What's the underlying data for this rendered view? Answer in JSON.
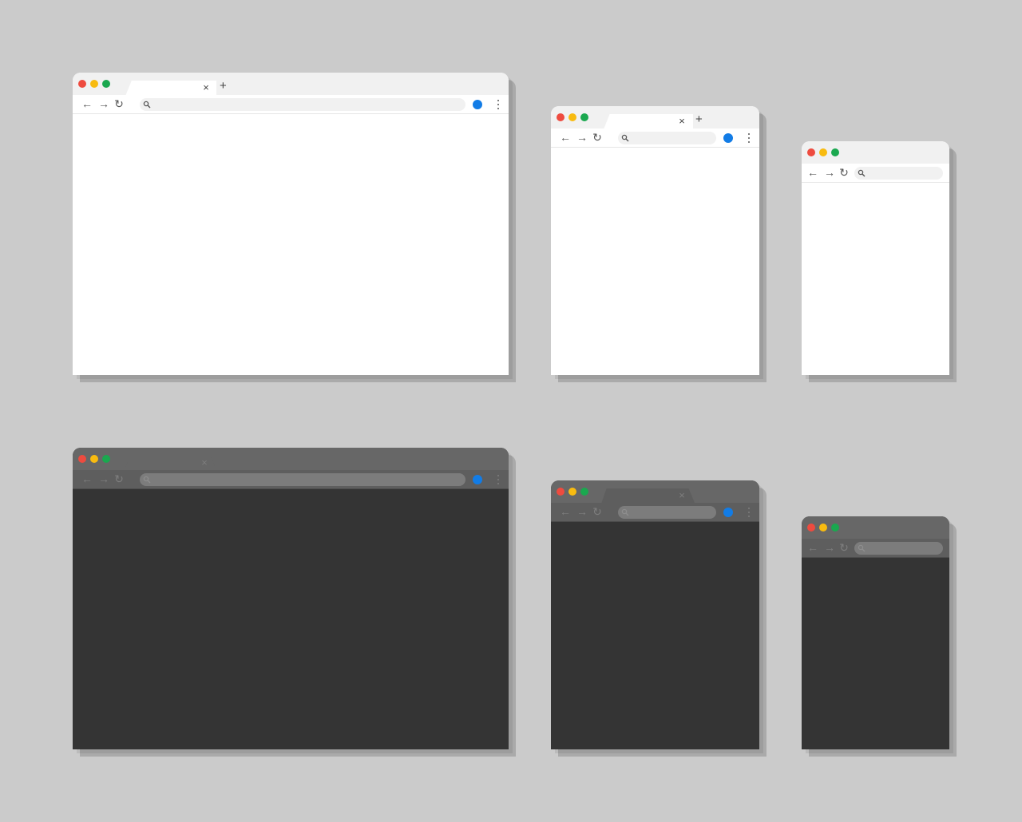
{
  "theme_colors": {
    "desktop_background": "#cbcbcb",
    "light_chrome": "#f1f1f1",
    "light_content": "#ffffff",
    "dark_chrome": "#676767",
    "dark_content": "#343434",
    "traffic_red": "#ee4b3f",
    "traffic_yellow": "#f8bb10",
    "traffic_green": "#1aa84f",
    "profile_blue": "#127ce6"
  },
  "icons": {
    "close_tab": "×",
    "new_tab": "+",
    "back": "←",
    "forward": "→",
    "reload": "↻",
    "search": "search-icon",
    "menu": "kebab-menu-icon"
  },
  "windows": [
    {
      "id": "light-large",
      "theme": "light",
      "has_tab": true,
      "has_new_tab": true,
      "has_profile": true,
      "has_menu": true
    },
    {
      "id": "light-medium",
      "theme": "light",
      "has_tab": true,
      "has_new_tab": true,
      "has_profile": true,
      "has_menu": true
    },
    {
      "id": "light-small",
      "theme": "light",
      "has_tab": false,
      "has_new_tab": false,
      "has_profile": false,
      "has_menu": false
    },
    {
      "id": "dark-large",
      "theme": "dark",
      "has_tab": true,
      "has_new_tab": false,
      "has_profile": true,
      "has_menu": true
    },
    {
      "id": "dark-medium",
      "theme": "dark",
      "has_tab": true,
      "has_new_tab": false,
      "has_profile": true,
      "has_menu": true
    },
    {
      "id": "dark-small",
      "theme": "dark",
      "has_tab": false,
      "has_new_tab": false,
      "has_profile": false,
      "has_menu": false
    }
  ]
}
